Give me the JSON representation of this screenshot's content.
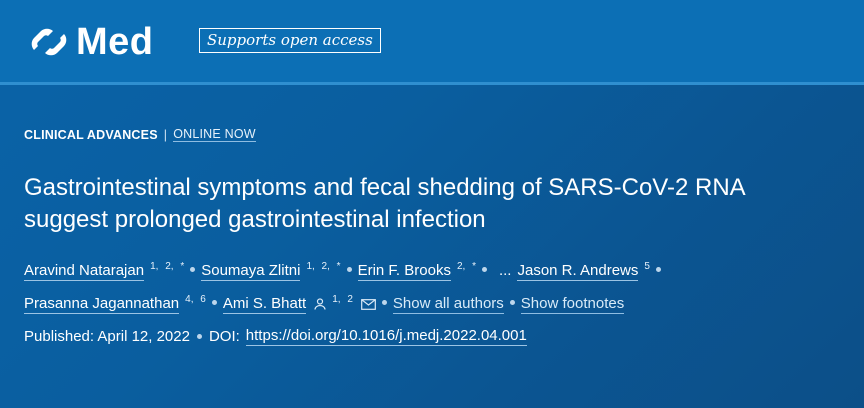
{
  "header": {
    "brand": "Med",
    "badge": "Supports open access",
    "logo_icon": "cell-press-logo-icon"
  },
  "article": {
    "type": "CLINICAL ADVANCES",
    "separator": "|",
    "status": "ONLINE NOW",
    "title_line1": "Gastrointestinal symptoms and fecal shedding of SARS-CoV-2 RNA",
    "title_line2": "suggest prolonged gastrointestinal infection",
    "authors": [
      {
        "name": "Aravind Natarajan",
        "affil": "1, 2, *"
      },
      {
        "name": "Soumaya Zlitni",
        "affil": "1, 2, *"
      },
      {
        "name": "Erin F. Brooks",
        "affil": "2, *"
      },
      {
        "name": "Jason R. Andrews",
        "affil": "5"
      },
      {
        "name": "Prasanna Jagannathan",
        "affil": "4, 6"
      },
      {
        "name": "Ami S. Bhatt",
        "affil": "1, 2"
      }
    ],
    "ellipsis": "...",
    "show_all_authors": "Show all authors",
    "show_footnotes": "Show footnotes",
    "published_label": "Published: April 12, 2022",
    "doi_label": "DOI:",
    "doi_link": "https://doi.org/10.1016/j.medj.2022.04.001"
  },
  "colors": {
    "background": "#0a5e9f",
    "header": "#0c6fb5",
    "text": "#ffffff"
  }
}
